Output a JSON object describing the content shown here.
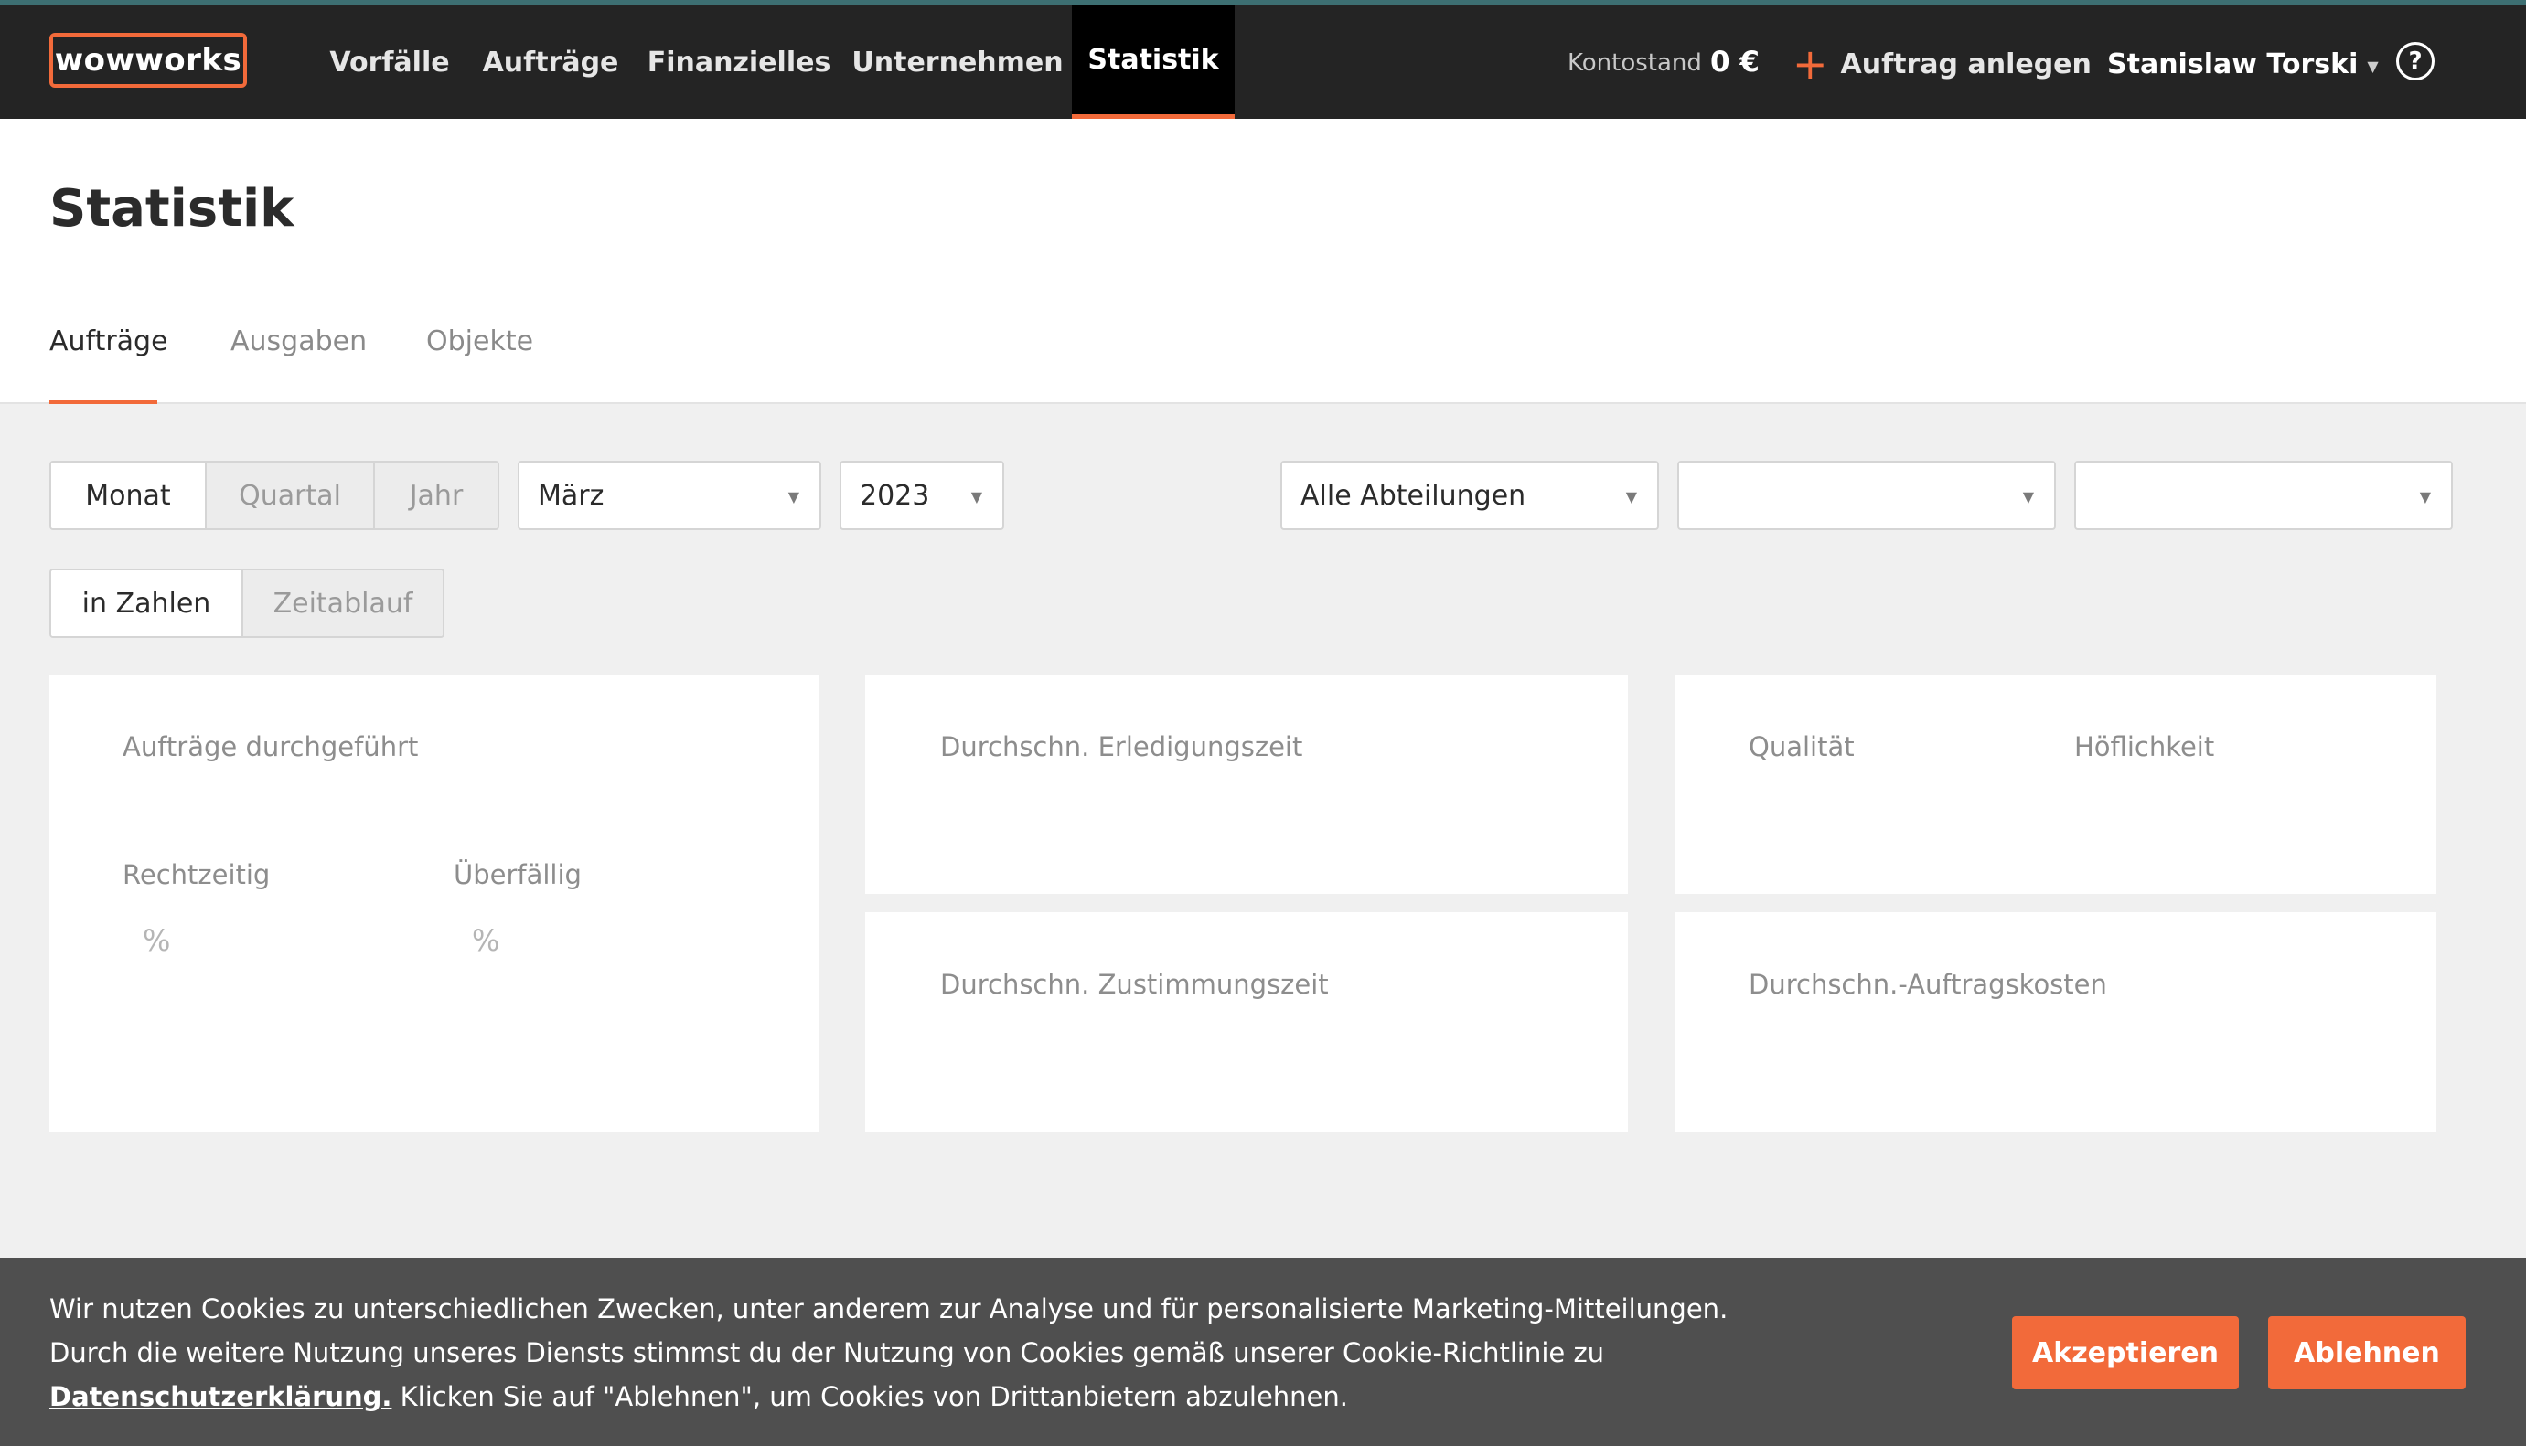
{
  "brand": {
    "logo": "wowworks"
  },
  "nav": {
    "items": [
      {
        "label": "Vorfälle"
      },
      {
        "label": "Aufträge"
      },
      {
        "label": "Finanzielles"
      },
      {
        "label": "Unternehmen"
      },
      {
        "label": "Statistik",
        "active": true
      }
    ],
    "balance_label": "Kontostand",
    "balance_value": "0 €",
    "create_order_label": "Auftrag anlegen",
    "user_name": "Stanislaw Torski",
    "help_icon": "?"
  },
  "page": {
    "title": "Statistik",
    "tabs": [
      {
        "label": "Aufträge",
        "active": true
      },
      {
        "label": "Ausgaben"
      },
      {
        "label": "Objekte"
      }
    ]
  },
  "filters": {
    "period": [
      {
        "label": "Monat",
        "active": true
      },
      {
        "label": "Quartal"
      },
      {
        "label": "Jahr"
      }
    ],
    "month_select": "März",
    "year_select": "2023",
    "department_select": "Alle Abteilungen",
    "select_2": "",
    "select_3": "",
    "view": [
      {
        "label": "in Zahlen",
        "active": true
      },
      {
        "label": "Zeitablauf"
      }
    ]
  },
  "cards": {
    "orders_done": "Aufträge durchgeführt",
    "on_time": "Rechtzeitig",
    "on_time_pct": "%",
    "overdue": "Überfällig",
    "overdue_pct": "%",
    "avg_completion": "Durchschn. Erledigungszeit",
    "avg_approval": "Durchschn. Zustimmungszeit",
    "quality": "Qualität",
    "politeness": "Höflichkeit",
    "avg_cost": "Durchschn.-Auftragskosten"
  },
  "cookie": {
    "text_before": "Wir nutzen Cookies zu unterschiedlichen Zwecken, unter anderem zur Analyse und für personalisierte Marketing-Mitteilungen. Durch die weitere Nutzung unseres Diensts stimmst du der Nutzung von Cookies gemäß unserer Cookie-Richtlinie zu ",
    "link": "Datenschutzerklärung.",
    "text_after": " Klicken Sie auf \"Ablehnen\", um Cookies von Drittanbietern abzulehnen.",
    "accept": "Akzeptieren",
    "decline": "Ablehnen"
  },
  "colors": {
    "accent": "#f26a3a",
    "topbar": "#242424",
    "background": "#f0f0f0",
    "cookie_bg": "#4f4f4f"
  }
}
